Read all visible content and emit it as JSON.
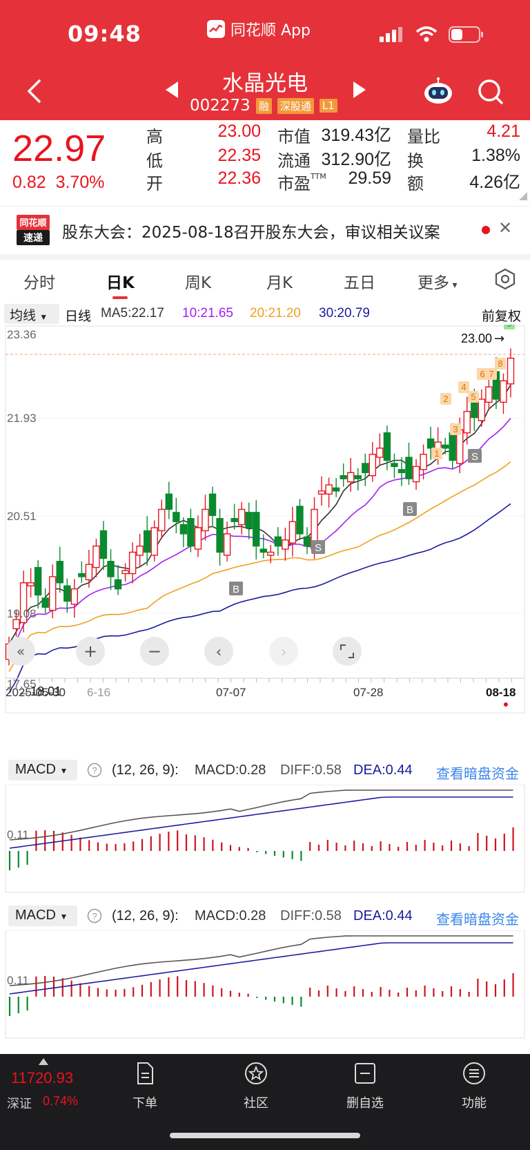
{
  "status": {
    "time": "09:48",
    "app": "同花顺 App"
  },
  "header": {
    "name": "水晶光电",
    "code": "002273",
    "tags": [
      "融",
      "深股通",
      "L1"
    ]
  },
  "quote": {
    "price": "22.97",
    "change": "0.82",
    "change_pct": "3.70%",
    "high_label": "高",
    "high": "23.00",
    "low_label": "低",
    "low": "22.35",
    "open_label": "开",
    "open": "22.36",
    "mktcap_label": "市值",
    "mktcap": "319.43亿",
    "float_label": "流通",
    "float": "312.90亿",
    "pe_label": "市盈",
    "pe_sup": "TTM",
    "pe": "29.59",
    "vr_label": "量比",
    "vr": "4.21",
    "turn_label": "换",
    "turn": "1.38%",
    "amount_label": "额",
    "amount": "4.26亿"
  },
  "news": {
    "logo_top": "同花顺",
    "logo_bottom": "速递",
    "text": "股东大会：2025-08-18召开股东大会，审议相关议案"
  },
  "tabs": [
    "分时",
    "日K",
    "周K",
    "月K",
    "五日",
    "更多"
  ],
  "ma": {
    "selector": "均线",
    "period": "日线",
    "ma5": "MA5:22.17",
    "ma10": "10:21.65",
    "ma20": "20:21.20",
    "ma30": "30:20.79",
    "adjust": "前复权"
  },
  "kline": {
    "y_labels": [
      "23.36",
      "21.93",
      "20.51",
      "19.08",
      "17.65"
    ],
    "max_label": "23.00",
    "min_label": "←18.01",
    "dates": [
      "2025-05-30",
      "6-16",
      "07-07",
      "07-28",
      "08-18"
    ],
    "markers": [
      "B",
      "S",
      "B",
      "S",
      "B"
    ],
    "counts": [
      "1",
      "2",
      "3",
      "4",
      "5",
      "6",
      "7",
      "8",
      "9"
    ]
  },
  "macd1": {
    "selector": "MACD",
    "params": "(12, 26, 9):",
    "macd": "MACD:0.28",
    "diff": "DIFF:0.58",
    "dea": "DEA:0.44",
    "link": "查看暗盘资金",
    "ylabel": "0.11"
  },
  "macd2": {
    "selector": "MACD",
    "params": "(12, 26, 9):",
    "macd": "MACD:0.28",
    "diff": "DIFF:0.58",
    "dea": "DEA:0.44",
    "link": "查看暗盘资金",
    "ylabel": "0.11"
  },
  "bottom": {
    "index_value": "11720.93",
    "index_name": "深证",
    "index_change": "0.74%",
    "items": [
      "下单",
      "社区",
      "删自选",
      "功能"
    ]
  },
  "colors": {
    "red": "#e5323a",
    "up": "#e8141f",
    "down": "#0a8a2e",
    "ma5": "#333333",
    "ma10": "#a020f0",
    "ma20": "#f0a020",
    "ma30": "#1a1aa0"
  }
}
